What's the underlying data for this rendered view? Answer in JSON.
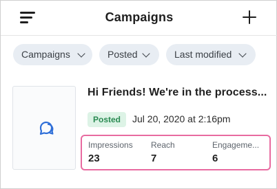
{
  "header": {
    "title": "Campaigns",
    "menu_icon": "hamburger-menu-icon",
    "add_icon": "plus-icon"
  },
  "filters": [
    {
      "label": "Campaigns"
    },
    {
      "label": "Posted"
    },
    {
      "label": "Last modified"
    }
  ],
  "post": {
    "title": "Hi Friends! We're in the process...",
    "status": "Posted",
    "date": "Jul 20, 2020 at 2:16pm",
    "thumbnail_icon": "chat-bubbles-icon",
    "stats": [
      {
        "label": "Impressions",
        "value": "23"
      },
      {
        "label": "Reach",
        "value": "7"
      },
      {
        "label": "Engageme...",
        "value": "6"
      }
    ]
  },
  "colors": {
    "chip_bg": "#e8edf3",
    "badge_bg": "#ddf3e6",
    "badge_text": "#2a8a52",
    "highlight_border": "#e86aa0",
    "icon_blue": "#2f6fd8"
  }
}
